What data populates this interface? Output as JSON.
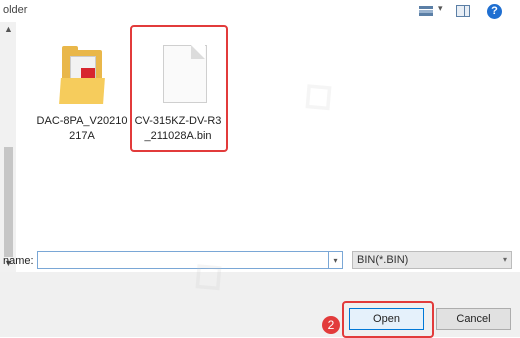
{
  "header": {
    "folder_label": "older"
  },
  "toolbar": {
    "view_icon": "view-details-icon",
    "view_caret_icon": "chevron-down-icon",
    "preview_icon": "preview-pane-icon",
    "help_icon": "help-icon",
    "help_glyph": "?"
  },
  "files": [
    {
      "name": "DAC-8PA_V20210217A",
      "icon": "folder-icon"
    },
    {
      "name": "CV-315KZ-DV-R3_211028A.bin",
      "icon": "file-icon"
    }
  ],
  "filename": {
    "label": "name:",
    "value": ""
  },
  "filetype": {
    "selected": "BIN(*.BIN)"
  },
  "buttons": {
    "open": "Open",
    "cancel": "Cancel"
  },
  "annotation": {
    "step": "2",
    "highlight_color": "#e23b3b"
  },
  "colors": {
    "accent": "#0078d7",
    "help_blue": "#1f6fd1",
    "folder": "#e9b74a"
  }
}
